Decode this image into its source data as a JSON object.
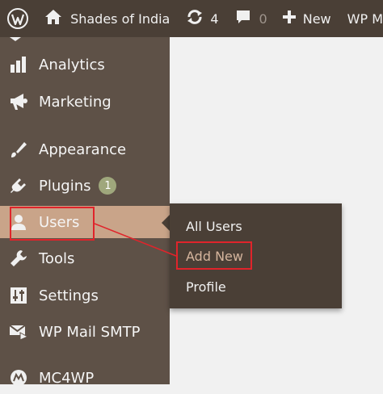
{
  "admin_bar": {
    "logo_icon": "wordpress-icon",
    "site_name": "Shades of India",
    "site_icon": "home-icon",
    "updates_count": "4",
    "updates_icon": "refresh-icon",
    "comments_count": "0",
    "comments_icon": "comment-bubble-icon",
    "new_label": "New",
    "new_icon": "plus-icon",
    "truncated_item": "WP M"
  },
  "sidebar": {
    "items": [
      {
        "label": "Analytics",
        "icon": "bar-chart-icon"
      },
      {
        "label": "Marketing",
        "icon": "megaphone-icon"
      },
      {
        "label": "Appearance",
        "icon": "paintbrush-icon"
      },
      {
        "label": "Plugins",
        "icon": "plugin-icon",
        "badge": "1"
      },
      {
        "label": "Users",
        "icon": "user-icon",
        "active": true
      },
      {
        "label": "Tools",
        "icon": "wrench-icon"
      },
      {
        "label": "Settings",
        "icon": "sliders-icon"
      },
      {
        "label": "WP Mail SMTP",
        "icon": "mail-icon"
      },
      {
        "label": "MC4WP",
        "icon": "mc4wp-icon"
      }
    ]
  },
  "users_submenu": {
    "items": [
      {
        "label": "All Users"
      },
      {
        "label": "Add New",
        "current": true
      },
      {
        "label": "Profile"
      }
    ]
  },
  "colors": {
    "admin_bar_bg": "#4a3f36",
    "sidebar_bg": "#5e5147",
    "active_bg": "#c9a489",
    "highlight_red": "#e0242b",
    "badge_bg": "#9fa77c",
    "content_bg": "#f1f1f1"
  }
}
